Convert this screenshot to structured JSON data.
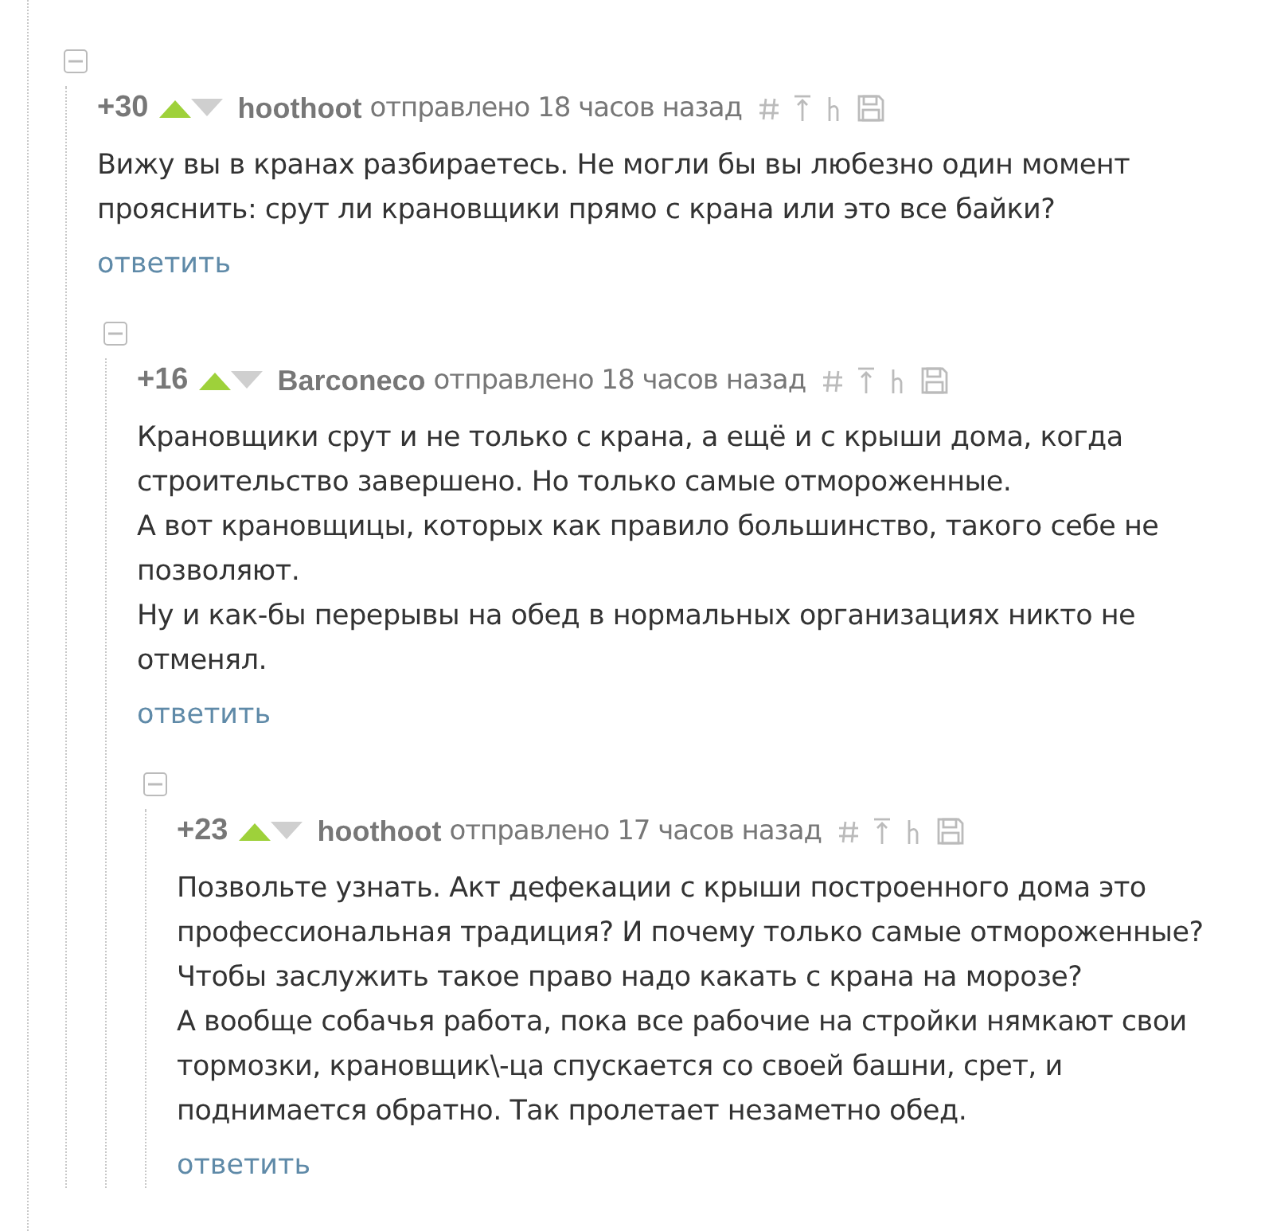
{
  "comments": [
    {
      "score": "+30",
      "vote_up": true,
      "vote_down": false,
      "author": "hoothoot",
      "sent": "отправлено 18 часов назад",
      "expanded": true,
      "paragraphs": [
        "Вижу вы в кранах разбираетесь. Не могли бы вы любезно один момент прояснить: срут ли крановщики прямо с крана или это все байки?"
      ],
      "reply": "ответить",
      "children": [
        {
          "score": "+16",
          "vote_up": true,
          "vote_down": false,
          "author": "Barconeco",
          "sent": "отправлено 18 часов назад",
          "expanded": true,
          "paragraphs": [
            "Крановщики срут и не только с крана, а ещё и с крыши дома, когда строительство завершено. Но только самые отмороженные.",
            "А вот крановщицы, которых как правило большинство, такого себе не позволяют.",
            "Ну и как-бы перерывы на обед в нормальных организациях никто не отменял."
          ],
          "reply": "ответить",
          "children": [
            {
              "score": "+23",
              "vote_up": true,
              "vote_down": false,
              "author": "hoothoot",
              "sent": "отправлено 17 часов назад",
              "expanded": true,
              "paragraphs": [
                "Позвольте узнать. Акт дефекации с крыши построенного дома это профессиональная традиция? И почему только самые отмороженные? Чтобы заслужить такое право надо какать с крана на морозе?",
                "А вообще собачья работа, пока все рабочие на стройки нямкают свои тормозки, крановщик\\-ца спускается со своей башни, срет, и поднимается обратно. Так пролетает незаметно обед."
              ],
              "reply": "ответить"
            }
          ]
        }
      ]
    }
  ]
}
